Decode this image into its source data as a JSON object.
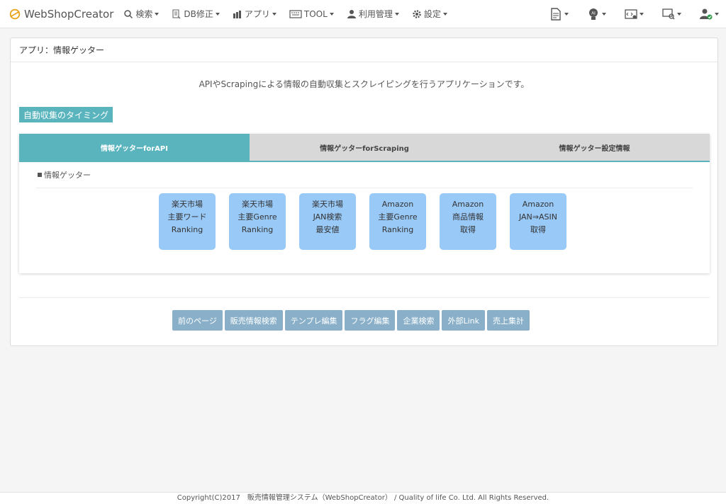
{
  "navbar": {
    "brand": "WebShopCreator",
    "items": [
      {
        "label": "検索",
        "icon": "search-icon"
      },
      {
        "label": "DB修正",
        "icon": "database-edit-icon"
      },
      {
        "label": "アプリ",
        "icon": "app-icon"
      },
      {
        "label": "TOOL",
        "icon": "keyboard-icon"
      },
      {
        "label": "利用管理",
        "icon": "user-icon"
      },
      {
        "label": "設定",
        "icon": "gear-icon"
      }
    ],
    "right_icons": [
      "document-icon",
      "ai-bulb-icon",
      "code-settings-icon",
      "chat-search-icon",
      "user-check-icon"
    ]
  },
  "panel": {
    "heading": "アプリ：情報ゲッター",
    "description": "APIやScrapingによる情報の自動収集とスクレイピングを行うアプリケーションです。",
    "timing_label": "自動収集のタイミング",
    "tabs": [
      {
        "label": "情報ゲッターforAPI",
        "active": true
      },
      {
        "label": "情報ゲッターforScraping",
        "active": false
      },
      {
        "label": "情報ゲッター設定情報",
        "active": false
      }
    ],
    "section_label": "情報ゲッター",
    "cards": [
      {
        "lines": [
          "楽天市場",
          "主要ワード",
          "Ranking"
        ]
      },
      {
        "lines": [
          "楽天市場",
          "主要Genre",
          "Ranking"
        ]
      },
      {
        "lines": [
          "楽天市場",
          "JAN検索",
          "最安値"
        ]
      },
      {
        "lines": [
          "Amazon",
          "主要Genre",
          "Ranking"
        ]
      },
      {
        "lines": [
          "Amazon",
          "商品情報",
          "取得"
        ]
      },
      {
        "lines": [
          "Amazon",
          "JAN⇒ASIN",
          "取得"
        ]
      }
    ],
    "buttons": [
      "前のページ",
      "販売情報検索",
      "テンプレ編集",
      "フラグ編集",
      "企業検索",
      "外部Link",
      "売上集計"
    ]
  },
  "footer": {
    "text": "Copyright(C)2017　販売情報管理システム（WebShopCreator） / Quality of life Co. Ltd. All Rights Reserved."
  },
  "colors": {
    "accent": "#5ab4bd",
    "card": "#99c9f7",
    "button": "#8ab0c9",
    "tab_inactive": "#d8d8d8"
  }
}
